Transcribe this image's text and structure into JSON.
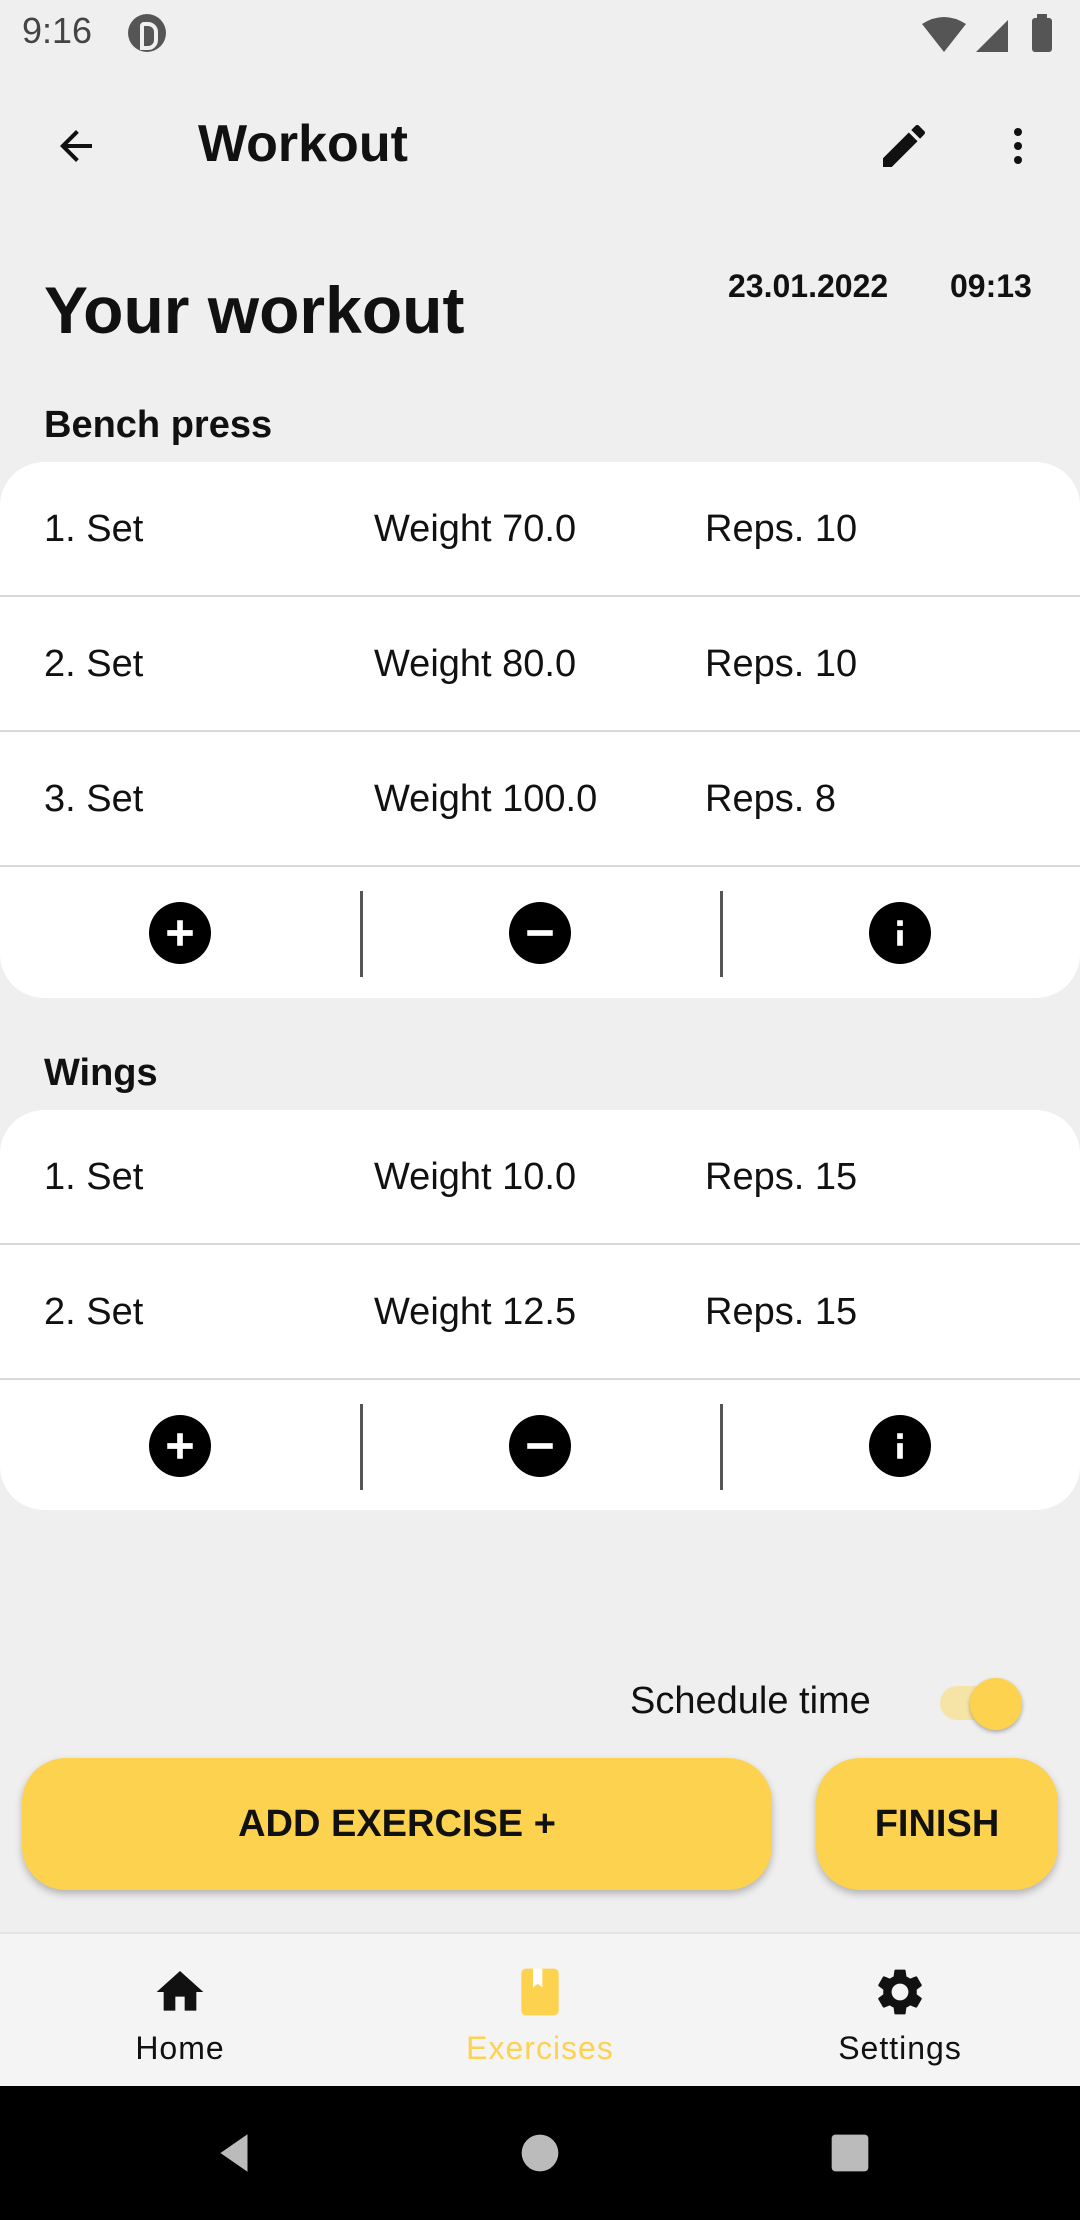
{
  "status_bar": {
    "time": "9:16"
  },
  "app_bar": {
    "title": "Workout"
  },
  "header": {
    "title": "Your workout",
    "date": "23.01.2022",
    "time": "09:13"
  },
  "exercises": [
    {
      "name": "Bench press",
      "sets": [
        {
          "label": "1. Set",
          "weight": "Weight 70.0",
          "reps": "Reps. 10"
        },
        {
          "label": "2. Set",
          "weight": "Weight 80.0",
          "reps": "Reps. 10"
        },
        {
          "label": "3. Set",
          "weight": "Weight 100.0",
          "reps": "Reps. 8"
        }
      ]
    },
    {
      "name": "Wings",
      "sets": [
        {
          "label": "1. Set",
          "weight": "Weight 10.0",
          "reps": "Reps. 15"
        },
        {
          "label": "2. Set",
          "weight": "Weight 12.5",
          "reps": "Reps. 15"
        }
      ]
    }
  ],
  "schedule": {
    "label": "Schedule time",
    "enabled": true
  },
  "actions": {
    "add_exercise": "ADD EXERCISE +",
    "finish": "FINISH"
  },
  "bottom_nav": {
    "items": [
      {
        "label": "Home",
        "icon": "home-icon"
      },
      {
        "label": "Exercises",
        "icon": "bookmark-icon"
      },
      {
        "label": "Settings",
        "icon": "gear-icon"
      }
    ],
    "active": "Exercises"
  },
  "colors": {
    "accent": "#fdd24e",
    "background": "#efefef",
    "card": "#ffffff"
  }
}
